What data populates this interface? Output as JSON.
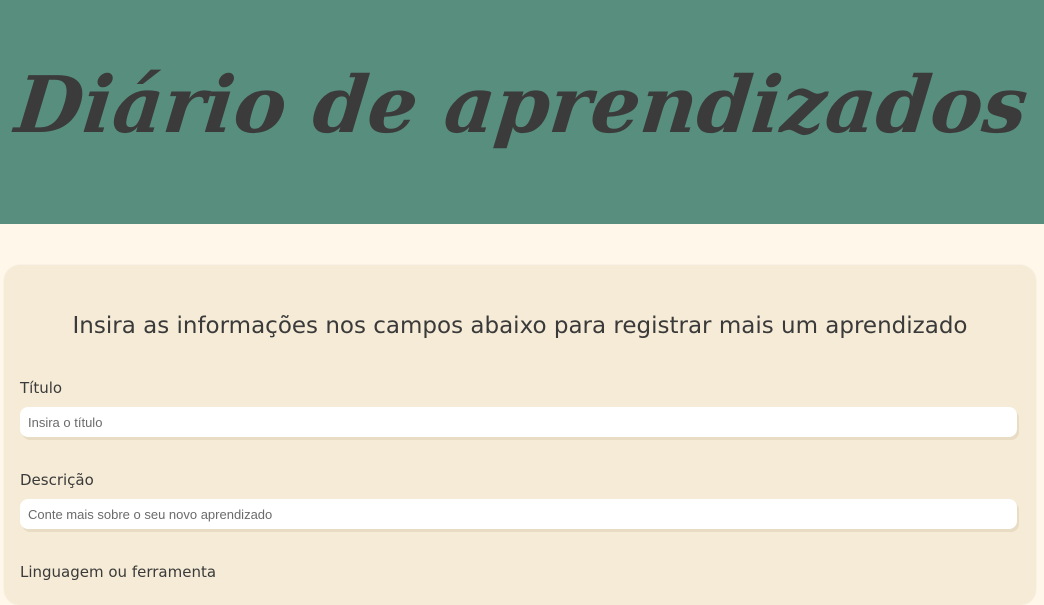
{
  "header": {
    "title": "Diário de aprendizados"
  },
  "form": {
    "intro": "Insira as informações nos campos abaixo para registrar mais um aprendizado",
    "fields": [
      {
        "label": "Título",
        "placeholder": "Insira o título",
        "value": ""
      },
      {
        "label": "Descrição",
        "placeholder": "Conte mais sobre o seu novo aprendizado",
        "value": ""
      },
      {
        "label": "Linguagem ou ferramenta"
      }
    ]
  },
  "colors": {
    "header_bg": "#578e7d",
    "page_bg": "#fff8ea",
    "card_bg": "#f5ebd6",
    "text": "#3a3a3a"
  }
}
